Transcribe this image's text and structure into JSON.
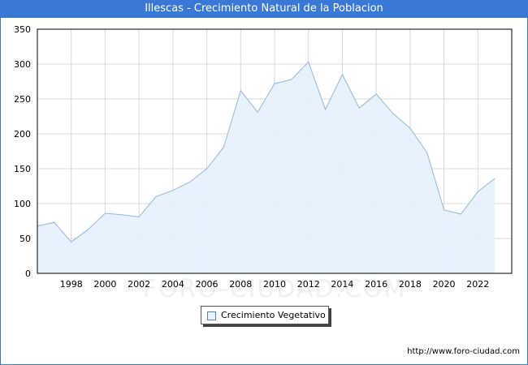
{
  "title": "Illescas - Crecimiento Natural de la Poblacion",
  "footer_url": "http://www.foro-ciudad.com",
  "watermark": "FORO-CIUDAD.COM",
  "colors": {
    "header": "#3a78d8",
    "area_fill": "#e5f1fd",
    "line": "#8db8e3",
    "grid": "#d8d8d8"
  },
  "chart_data": {
    "type": "area",
    "title": "Illescas - Crecimiento Natural de la Poblacion",
    "xlabel": "",
    "ylabel": "",
    "xlim": [
      1996,
      2024
    ],
    "ylim": [
      0,
      350
    ],
    "y_ticks": [
      0,
      50,
      100,
      150,
      200,
      250,
      300,
      350
    ],
    "x_ticks": [
      1998,
      2000,
      2002,
      2004,
      2006,
      2008,
      2010,
      2012,
      2014,
      2016,
      2018,
      2020,
      2022
    ],
    "grid": true,
    "legend_position": "bottom-center",
    "series": [
      {
        "name": "Crecimiento Vegetativo",
        "x": [
          1996,
          1997,
          1998,
          1999,
          2000,
          2001,
          2002,
          2003,
          2004,
          2005,
          2006,
          2007,
          2008,
          2009,
          2010,
          2011,
          2012,
          2013,
          2014,
          2015,
          2016,
          2017,
          2018,
          2019,
          2020,
          2021,
          2022,
          2023
        ],
        "values": [
          68,
          73,
          45,
          63,
          86,
          84,
          81,
          110,
          119,
          131,
          150,
          181,
          262,
          231,
          272,
          278,
          303,
          235,
          285,
          237,
          257,
          229,
          208,
          173,
          91,
          85,
          117,
          136
        ]
      }
    ]
  }
}
